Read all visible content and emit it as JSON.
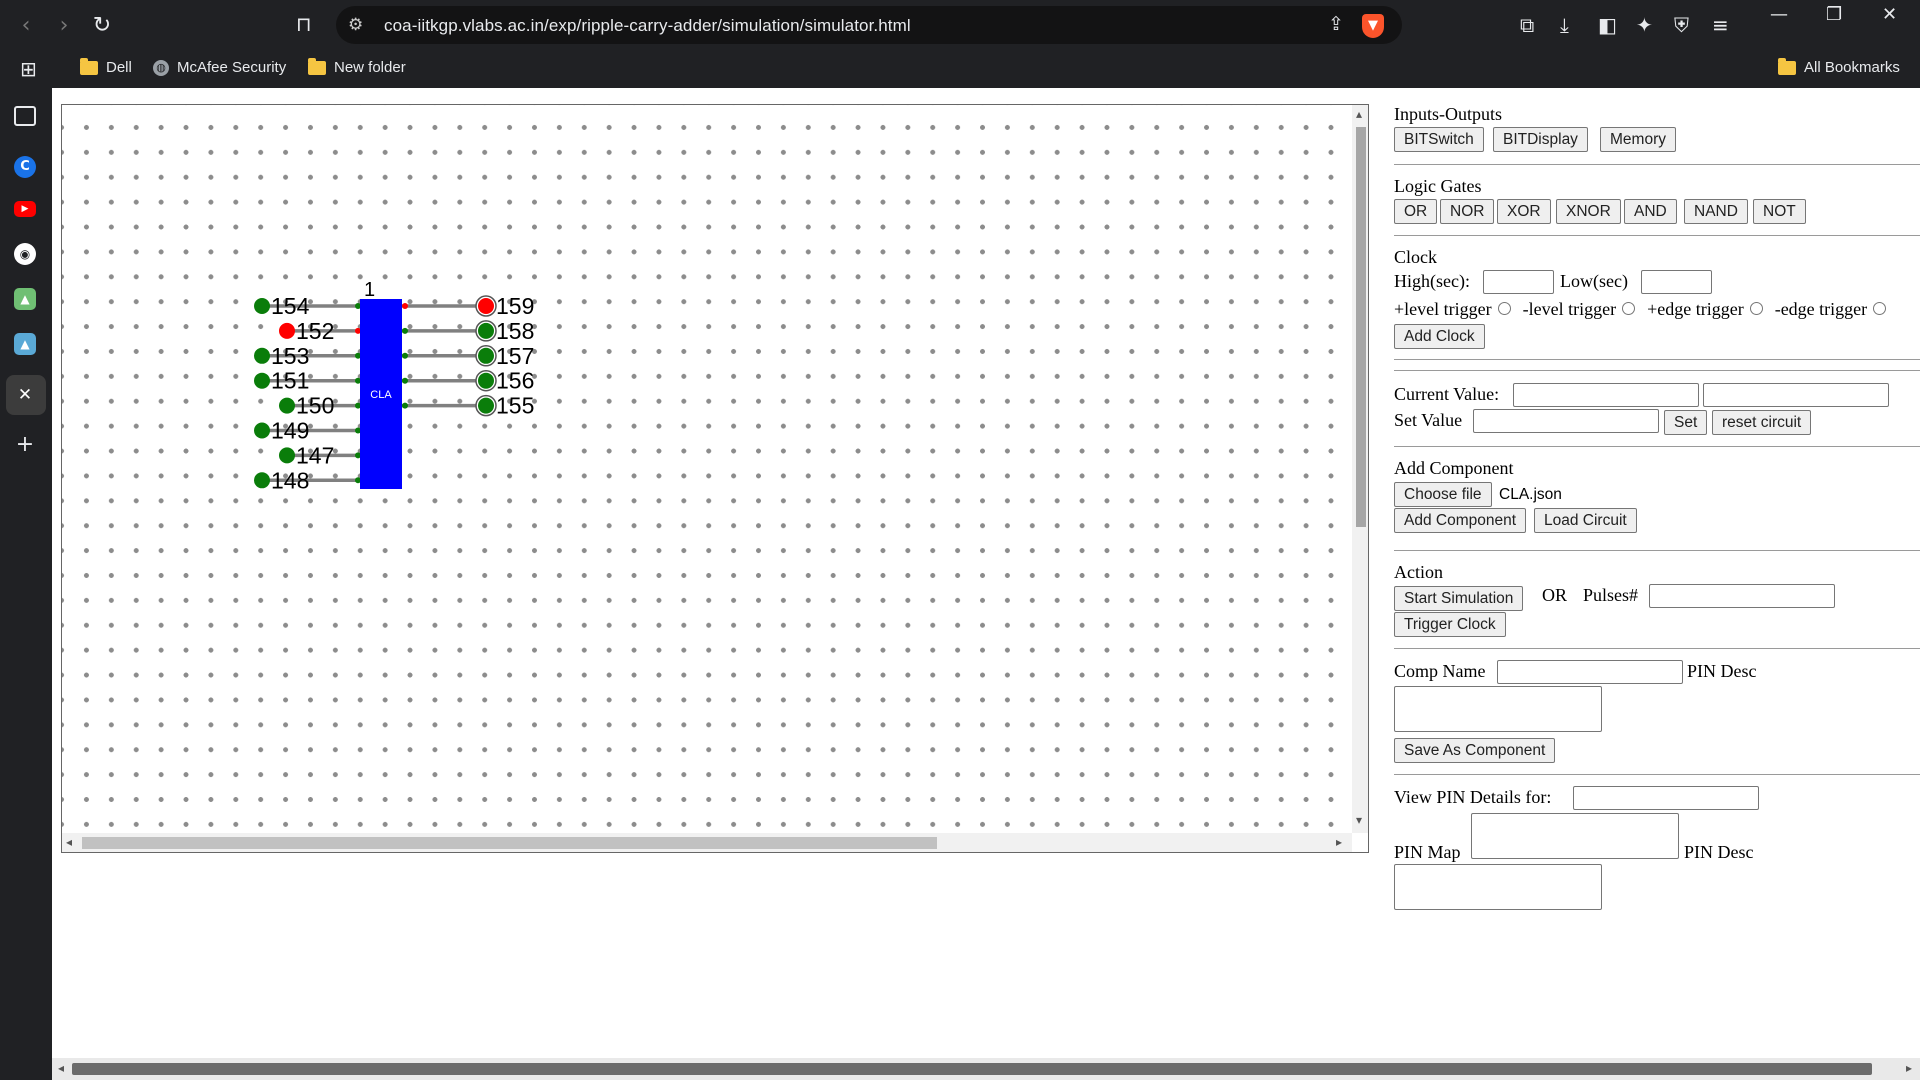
{
  "browser": {
    "url": "coa-iitkgp.vlabs.ac.in/exp/ripple-carry-adder/simulation/simulator.html",
    "bookmarks": [
      "Dell",
      "McAfee Security",
      "New folder"
    ],
    "all_bookmarks": "All Bookmarks",
    "sidebar_icons": [
      "sidebar-panel-icon",
      "c-app-icon",
      "youtube-icon",
      "github-icon",
      "image-app-icon",
      "image-app-icon-2",
      "close-x-icon",
      "add-icon"
    ]
  },
  "circuit": {
    "component_label": "CLA",
    "component_top_label": "1",
    "inputs": [
      {
        "label": "154",
        "state": "on"
      },
      {
        "label": "152",
        "state": "off"
      },
      {
        "label": "153",
        "state": "on"
      },
      {
        "label": "151",
        "state": "on"
      },
      {
        "label": "150",
        "state": "on"
      },
      {
        "label": "149",
        "state": "on"
      },
      {
        "label": "147",
        "state": "on"
      },
      {
        "label": "148",
        "state": "on"
      }
    ],
    "outputs": [
      {
        "label": "159",
        "state": "off"
      },
      {
        "label": "158",
        "state": "on"
      },
      {
        "label": "157",
        "state": "on"
      },
      {
        "label": "156",
        "state": "on"
      },
      {
        "label": "155",
        "state": "on"
      }
    ],
    "colors": {
      "on": "#0a7d0a",
      "off": "#ff0000",
      "component": "#0000ff",
      "wire": "#808080"
    }
  },
  "panel": {
    "io": {
      "title": "Inputs-Outputs",
      "buttons": [
        "BITSwitch",
        "BITDisplay",
        "Memory"
      ]
    },
    "gates": {
      "title": "Logic Gates",
      "buttons": [
        "OR",
        "NOR",
        "XOR",
        "XNOR",
        "AND",
        "NAND",
        "NOT"
      ]
    },
    "clock": {
      "title": "Clock",
      "high_label": "High(sec):",
      "low_label": "Low(sec)",
      "triggers": [
        "+level trigger",
        "-level trigger",
        "+edge trigger",
        "-edge trigger"
      ],
      "add_button": "Add Clock"
    },
    "value": {
      "current_label": "Current Value:",
      "set_label": "Set Value",
      "set_button": "Set",
      "reset_button": "reset circuit"
    },
    "add_component": {
      "title": "Add Component",
      "choose_button": "Choose file",
      "file_name": "CLA.json",
      "add_button": "Add Component",
      "load_button": "Load Circuit"
    },
    "action": {
      "title": "Action",
      "start_button": "Start Simulation",
      "or_label": "OR",
      "pulses_label": "Pulses#",
      "trigger_button": "Trigger Clock"
    },
    "save": {
      "comp_name_label": "Comp Name",
      "pin_desc_label": "PIN Desc",
      "save_button": "Save As Component"
    },
    "pins": {
      "view_label": "View PIN Details for:",
      "pin_map_label": "PIN Map",
      "pin_desc_label": "PIN Desc"
    }
  }
}
